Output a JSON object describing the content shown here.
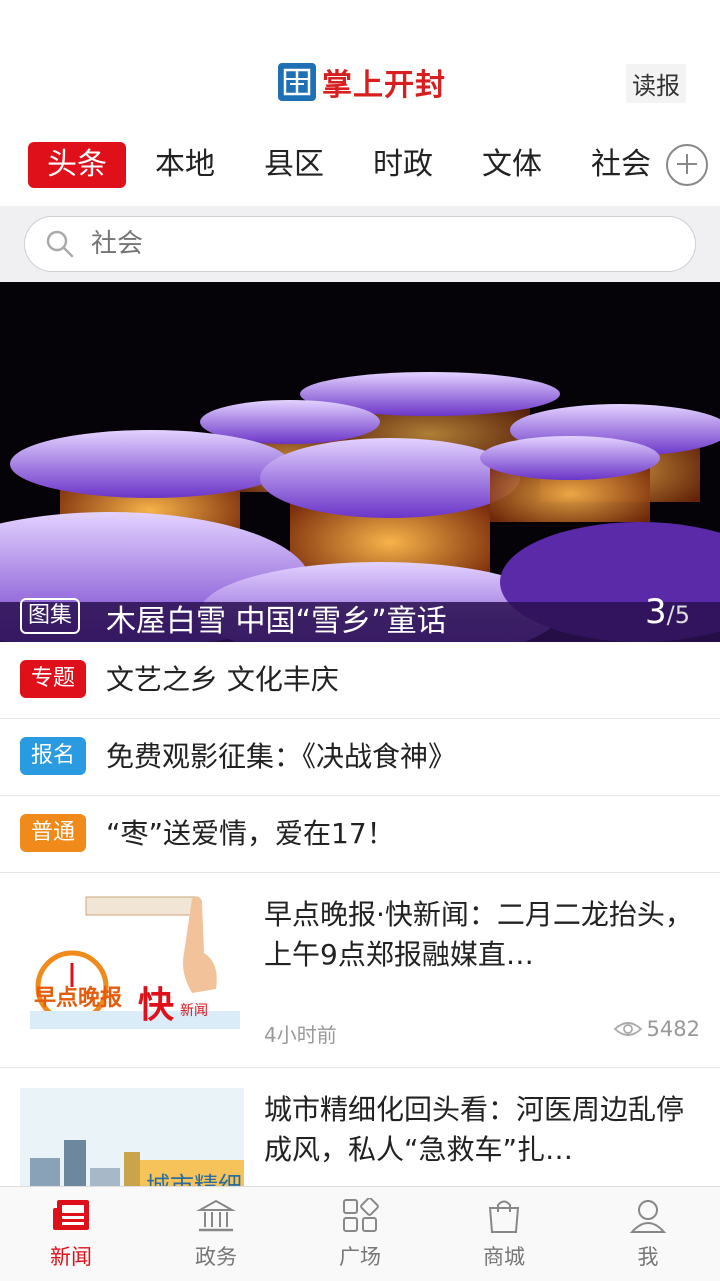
{
  "header": {
    "app_title": "掌上开封",
    "paper_button": "读报"
  },
  "tabs": [
    "头条",
    "本地",
    "县区",
    "时政",
    "文体",
    "社会"
  ],
  "search": {
    "placeholder": "社会"
  },
  "banner": {
    "tag": "图集",
    "title": "木屋白雪 中国“雪乡”童话",
    "page_current": "3",
    "page_total": "/5"
  },
  "topics": [
    {
      "badge": "专题",
      "badge_color": "#e0101a",
      "title": "文艺之乡 文化丰庆"
    },
    {
      "badge": "报名",
      "badge_color": "#2a9be0",
      "title": "免费观影征集：《决战食神》"
    },
    {
      "badge": "普通",
      "badge_color": "#f08a1a",
      "title": "“枣”送爱情，爱在17！"
    }
  ],
  "news": [
    {
      "title": "早点晚报·快新闻：二月二龙抬头，上午9点郑报融媒直…",
      "time": "4小时前",
      "views": "5482",
      "thumb_text_main": "早点晚报",
      "thumb_text_fast": "快",
      "thumb_text_news": "新闻"
    },
    {
      "title": "城市精细化回头看：河医周边乱停成风，私人“急救车”扎…",
      "thumb_text": "城市精细"
    }
  ],
  "bottom_nav": [
    {
      "label": "新闻",
      "icon": "newspaper-icon",
      "active": true
    },
    {
      "label": "政务",
      "icon": "government-building-icon",
      "active": false
    },
    {
      "label": "广场",
      "icon": "grid-apps-icon",
      "active": false
    },
    {
      "label": "商城",
      "icon": "shopping-bag-icon",
      "active": false
    },
    {
      "label": "我",
      "icon": "user-icon",
      "active": false
    }
  ],
  "colors": {
    "accent": "#e0101a",
    "brand_blue": "#1f6fb5"
  }
}
